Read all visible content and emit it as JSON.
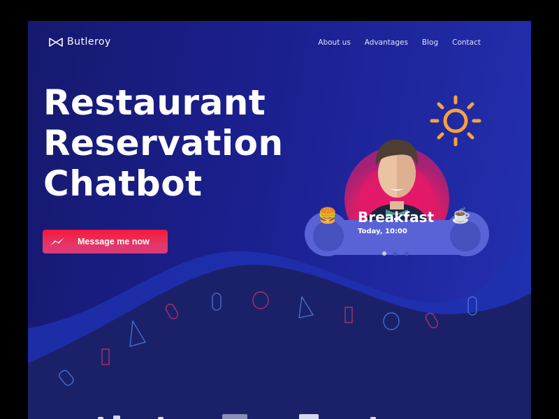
{
  "brand": {
    "name": "Butleroy",
    "icon": "bowtie-icon"
  },
  "nav": {
    "items": [
      {
        "label": "About us"
      },
      {
        "label": "Advantages"
      },
      {
        "label": "Blog"
      },
      {
        "label": "Contact"
      }
    ]
  },
  "hero": {
    "headline_lines": [
      "Restaurant",
      "Reservation",
      "Chatbot"
    ],
    "cta_label": "Message me now",
    "cta_icon": "messenger-icon"
  },
  "card": {
    "title": "Breakfast",
    "subtitle": "Today, 10:00",
    "left_icon": "🍔",
    "right_icon": "☕"
  },
  "carousel": {
    "count": 3,
    "active_index": 0
  },
  "colors": {
    "background": "#1b2090",
    "cta_top": "#f6193a",
    "cta_bottom": "#d83b80",
    "sun": "#f7a23b",
    "card": "#5a63d6"
  }
}
